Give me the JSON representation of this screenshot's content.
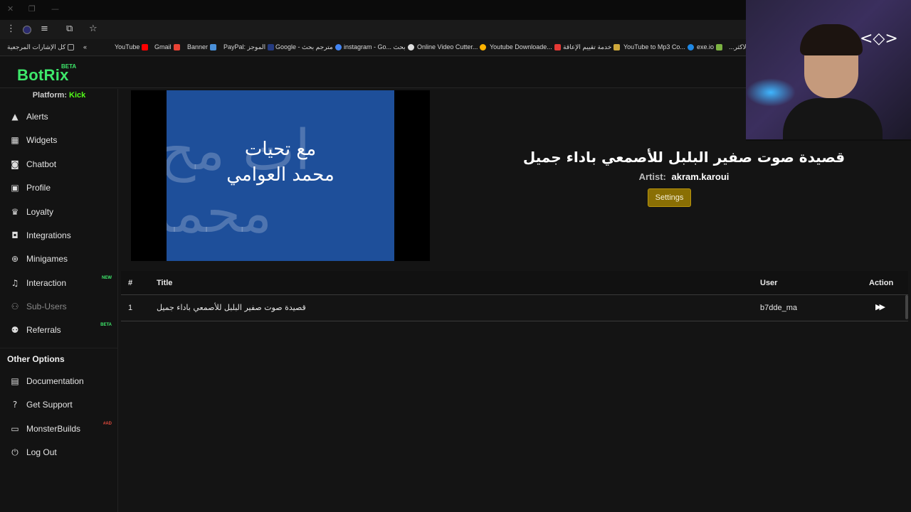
{
  "browser": {
    "bookmarks": [
      {
        "label": "كل الإشارات المرجعية",
        "color": "#888888"
      },
      {
        "label": "YouTube",
        "color": "#ff0000"
      },
      {
        "label": "Gmail",
        "color": "#ea4335"
      },
      {
        "label": "Banner",
        "color": "#4a90d9"
      },
      {
        "label": "PayPal: الموجز",
        "color": "#253b80"
      },
      {
        "label": "Google - مترجم بحث",
        "color": "#4285f4"
      },
      {
        "label": "instagram - Go... بحث",
        "color": "#e1306c"
      },
      {
        "label": "Online Video Cutter...",
        "color": "#ffb300"
      },
      {
        "label": "Youtube Downloade...",
        "color": "#e53935"
      },
      {
        "label": "خدمة تقييم الإعاقة",
        "color": "#cfa93b"
      },
      {
        "label": "YouTube to Mp3 Co...",
        "color": "#1e88e5"
      },
      {
        "label": "exe.io",
        "color": "#7cb342"
      },
      {
        "label": "...الاكثر",
        "color": "#888888"
      }
    ]
  },
  "brand": {
    "name": "BotRix",
    "badge": "BETA",
    "accent": "#3ee86b"
  },
  "platform": {
    "label": "Platform:",
    "value": "Kick"
  },
  "sidebar": {
    "items": [
      {
        "label": "Alerts",
        "icon": "warning-icon"
      },
      {
        "label": "Widgets",
        "icon": "table-icon"
      },
      {
        "label": "Chatbot",
        "icon": "robot-icon"
      },
      {
        "label": "Profile",
        "icon": "id-card-icon"
      },
      {
        "label": "Loyalty",
        "icon": "trophy-icon"
      },
      {
        "label": "Integrations",
        "icon": "discord-icon"
      },
      {
        "label": "Minigames",
        "icon": "gamepad-icon"
      },
      {
        "label": "Interaction",
        "icon": "music-icon",
        "tag": "NEW"
      },
      {
        "label": "Sub-Users",
        "icon": "users-icon"
      },
      {
        "label": "Referrals",
        "icon": "user-group-icon",
        "tag": "BETA"
      }
    ],
    "other_title": "Other Options",
    "other_items": [
      {
        "label": "Documentation",
        "icon": "book-icon"
      },
      {
        "label": "Get Support",
        "icon": "question-icon"
      },
      {
        "label": "MonsterBuilds",
        "icon": "laptop-icon",
        "tag": "#AD"
      },
      {
        "label": "Log Out",
        "icon": "power-icon"
      }
    ]
  },
  "player": {
    "thumbnail_caption_1": "مع تحيات",
    "thumbnail_caption_2": "محمد العوامي",
    "title": "قصيدة صوت صفير البلبل للأصمعي باداء جميل",
    "artist_label": "Artist:",
    "artist": "akram.karoui",
    "settings_label": "Settings"
  },
  "queue": {
    "headers": {
      "index": "#",
      "title": "Title",
      "user": "User",
      "action": "Action"
    },
    "rows": [
      {
        "index": "1",
        "title": "قصيدة صوت صفير البلبل للأصمعي باداء جميل",
        "user": "b7dde_ma",
        "action_icon": "forward-icon"
      }
    ]
  }
}
